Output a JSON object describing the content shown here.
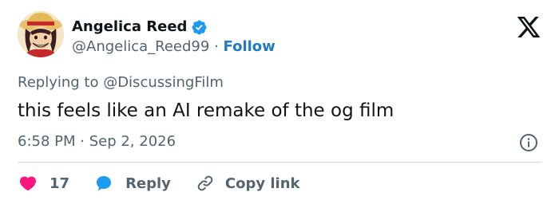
{
  "author": {
    "display_name": "Angelica Reed",
    "handle": "@Angelica_Reed99",
    "separator": "·",
    "follow_label": "Follow"
  },
  "tweet": {
    "replying_to": "Replying to @DiscussingFilm",
    "text": "this feels like an AI remake of the og film",
    "timestamp": "6:58 PM · Sep 2, 2026"
  },
  "actions": {
    "like_count": "17",
    "reply_label": "Reply",
    "copy_link_label": "Copy link"
  },
  "icons": {
    "verified": "verified-badge-icon",
    "brand": "x-logo-icon",
    "info": "info-icon",
    "like": "heart-icon",
    "reply": "reply-bubble-icon",
    "copy": "link-icon"
  },
  "colors": {
    "text": "#0f1419",
    "secondary": "#536471",
    "accent": "#1d9bf0",
    "follow": "#1d7bc0",
    "like": "#f91880",
    "divider": "#cfd9de"
  }
}
